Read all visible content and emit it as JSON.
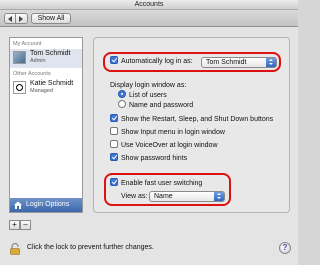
{
  "window": {
    "title": "Accounts"
  },
  "toolbar": {
    "show_all_label": "Show All"
  },
  "sidebar": {
    "my_account_header": "My Account",
    "my_account": {
      "name": "Tom Schmidt",
      "role": "Admin"
    },
    "other_accounts_header": "Other Accounts",
    "other_account": {
      "name": "Katie Schmidt",
      "role": "Managed"
    },
    "login_options_label": "Login Options",
    "add_label": "+",
    "remove_label": "–"
  },
  "main": {
    "auto_login": {
      "label": "Automatically log in as:",
      "checked": true,
      "value": "Tom Schmidt"
    },
    "display_header": "Display login window as:",
    "display_options": [
      {
        "label": "List of users",
        "selected": true
      },
      {
        "label": "Name and password",
        "selected": false
      }
    ],
    "checkboxes": [
      {
        "label": "Show the Restart, Sleep, and Shut Down buttons",
        "checked": true
      },
      {
        "label": "Show Input menu in login window",
        "checked": false
      },
      {
        "label": "Use VoiceOver at login window",
        "checked": false
      },
      {
        "label": "Show password hints",
        "checked": true
      }
    ],
    "fast_switching": {
      "label": "Enable fast user switching",
      "checked": true
    },
    "view_as": {
      "label": "View as:",
      "value": "Name"
    }
  },
  "footer": {
    "lock_message": "Click the lock to prevent further changes.",
    "help_label": "?"
  },
  "colors": {
    "highlight": "#d11111",
    "selection": "#3b67ad"
  }
}
